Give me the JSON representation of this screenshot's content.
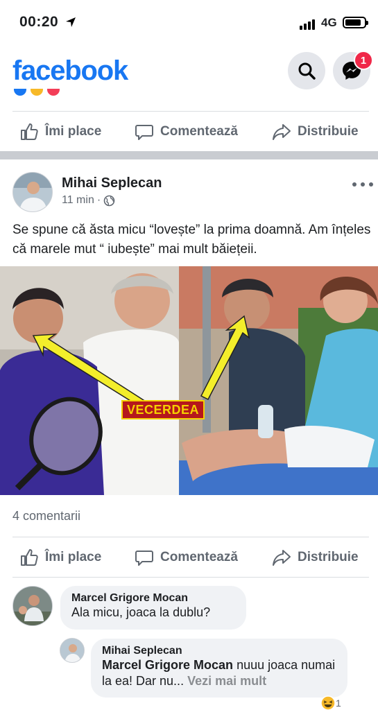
{
  "status_bar": {
    "time": "00:20",
    "network": "4G"
  },
  "header": {
    "logo": "facebook",
    "messenger_badge": "1"
  },
  "actions": {
    "like": "Îmi place",
    "comment": "Comentează",
    "share": "Distribuie"
  },
  "post": {
    "author": "Mihai Seplecan",
    "time": "11 min",
    "text": "Se spune că ăsta micu “lovește” la prima doamnă. Am înțeles că marele mut “ iubește” mai mult băiețeii.",
    "image_label": "VECERDEA",
    "comments_count": "4 comentarii"
  },
  "comments": [
    {
      "name": "Marcel Grigore Mocan",
      "text": "Ala micu, joaca la dublu?"
    },
    {
      "name": "Mihai Seplecan",
      "mention": "Marcel Grigore Mocan",
      "text": " nuuu joaca numai la ea! Dar nu...",
      "see_more": "Vezi mai mult",
      "reaction_count": "1"
    }
  ],
  "colors": {
    "brand": "#1877f2",
    "badge": "#f02849",
    "muted": "#606770"
  }
}
